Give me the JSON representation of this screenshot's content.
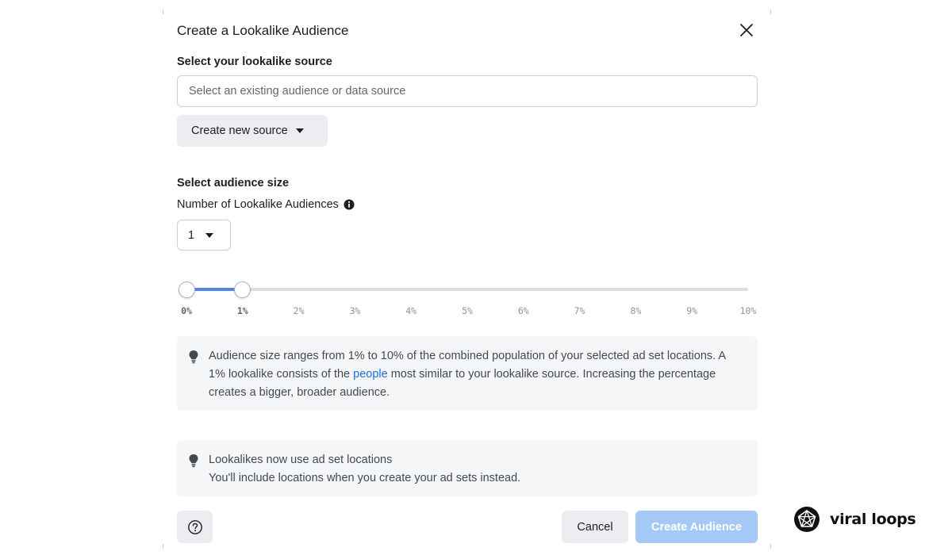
{
  "dialog": {
    "title": "Create a Lookalike Audience",
    "close_icon": "close-icon"
  },
  "source": {
    "label": "Select your lookalike source",
    "placeholder": "Select an existing audience or data source",
    "value": "",
    "create_button_label": "Create new source"
  },
  "size": {
    "label": "Select audience size",
    "count_label": "Number of Lookalike Audiences",
    "count_value": "1",
    "slider": {
      "min": 0,
      "max": 10,
      "range_start": 0,
      "range_end": 1,
      "tick_labels": [
        "0%",
        "1%",
        "2%",
        "3%",
        "4%",
        "5%",
        "6%",
        "7%",
        "8%",
        "9%",
        "10%"
      ]
    }
  },
  "notes": {
    "size_info": {
      "text_before_link": "Audience size ranges from 1% to 10% of the combined population of your selected ad set locations. A 1% lookalike consists of the ",
      "link": "people",
      "text_after_link": " most similar to your lookalike source. Increasing the percentage creates a bigger, broader audience."
    },
    "locations": {
      "line1": "Lookalikes now use ad set locations",
      "line2": "You'll include locations when you create your ad sets instead."
    }
  },
  "footer": {
    "help_icon": "help-icon",
    "cancel_label": "Cancel",
    "create_label": "Create Audience"
  },
  "brand": {
    "name": "viral loops"
  },
  "colors": {
    "accent": "#4f86ec",
    "primary_button_disabled": "#a5c9f7",
    "link": "#1a6ed8"
  }
}
